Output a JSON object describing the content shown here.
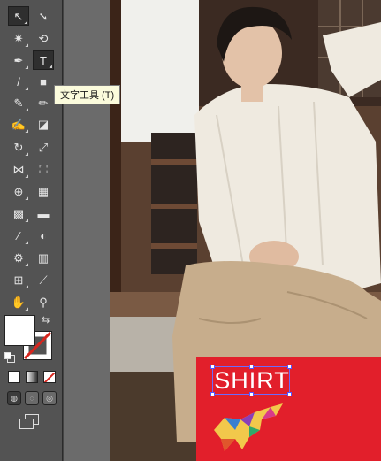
{
  "tooltip": {
    "text": "文字工具 (T)"
  },
  "tools": [
    {
      "name": "selection-tool-icon",
      "glyph": "↖"
    },
    {
      "name": "direct-selection-tool-icon",
      "glyph": "➘"
    },
    {
      "name": "magic-wand-tool-icon",
      "glyph": "✷"
    },
    {
      "name": "lasso-tool-icon",
      "glyph": "⟲"
    },
    {
      "name": "pen-tool-icon",
      "glyph": "✒"
    },
    {
      "name": "type-tool-icon",
      "glyph": "T"
    },
    {
      "name": "line-segment-tool-icon",
      "glyph": "/"
    },
    {
      "name": "rectangle-tool-icon",
      "glyph": "■"
    },
    {
      "name": "paintbrush-tool-icon",
      "glyph": "✎"
    },
    {
      "name": "pencil-tool-icon",
      "glyph": "✏"
    },
    {
      "name": "blob-brush-tool-icon",
      "glyph": "✍"
    },
    {
      "name": "eraser-tool-icon",
      "glyph": "◪"
    },
    {
      "name": "rotate-tool-icon",
      "glyph": "↻"
    },
    {
      "name": "scale-tool-icon",
      "glyph": "⤢"
    },
    {
      "name": "width-tool-icon",
      "glyph": "⋈"
    },
    {
      "name": "free-transform-tool-icon",
      "glyph": "⛶"
    },
    {
      "name": "shape-builder-tool-icon",
      "glyph": "⊕"
    },
    {
      "name": "perspective-grid-tool-icon",
      "glyph": "▦"
    },
    {
      "name": "mesh-tool-icon",
      "glyph": "▩"
    },
    {
      "name": "gradient-tool-icon",
      "glyph": "▬"
    },
    {
      "name": "eyedropper-tool-icon",
      "glyph": "⁄"
    },
    {
      "name": "blend-tool-icon",
      "glyph": "◐"
    },
    {
      "name": "symbol-sprayer-tool-icon",
      "glyph": "⚙"
    },
    {
      "name": "column-graph-tool-icon",
      "glyph": "▥"
    },
    {
      "name": "artboard-tool-icon",
      "glyph": "⊞"
    },
    {
      "name": "slice-tool-icon",
      "glyph": "⟋"
    },
    {
      "name": "hand-tool-icon",
      "glyph": "✋"
    },
    {
      "name": "zoom-tool-icon",
      "glyph": "⚲"
    }
  ],
  "canvas": {
    "text": "SHIRT"
  },
  "colors": {
    "fill": "#ffffff",
    "stroke_none": "#d7261e",
    "accent_red": "#e21f2b"
  }
}
